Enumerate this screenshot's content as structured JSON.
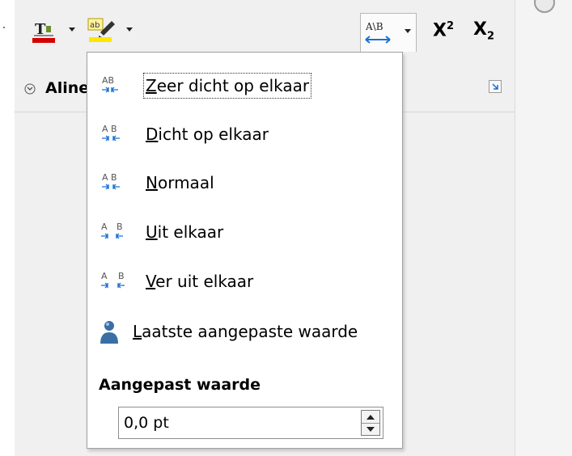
{
  "toolbar": {
    "spacing_button_glyph": "A\\B",
    "superscript": {
      "base": "X",
      "sup": "2"
    },
    "subscript": {
      "base": "X",
      "sub": "2"
    }
  },
  "section": {
    "title": "Aline"
  },
  "spacing_menu": {
    "items": [
      {
        "label": "Zeer dicht op elkaar",
        "mnemonic": "Z",
        "rest": "eer dicht op elkaar",
        "icon": "very-tight-spacing-icon",
        "focused": true
      },
      {
        "label": "Dicht op elkaar",
        "mnemonic": "D",
        "rest": "icht op elkaar",
        "icon": "tight-spacing-icon"
      },
      {
        "label": "Normaal",
        "mnemonic": "N",
        "rest": "ormaal",
        "icon": "normal-spacing-icon"
      },
      {
        "label": "Uit elkaar",
        "mnemonic": "U",
        "rest": "it elkaar",
        "icon": "loose-spacing-icon"
      },
      {
        "label": "Ver uit elkaar",
        "mnemonic": "V",
        "rest": "er uit elkaar",
        "icon": "very-loose-spacing-icon"
      },
      {
        "label": "Laatste aangepaste waarde",
        "mnemonic": "L",
        "rest": "aatste aangepaste waarde",
        "icon": "person-icon"
      }
    ],
    "custom_title": "Aangepast waarde",
    "custom_value": "0,0 pt"
  },
  "colors": {
    "font_color_bar": "#d40000",
    "highlight_bar": "#ffe600",
    "spacing_arrow": "#1a6fd6"
  }
}
